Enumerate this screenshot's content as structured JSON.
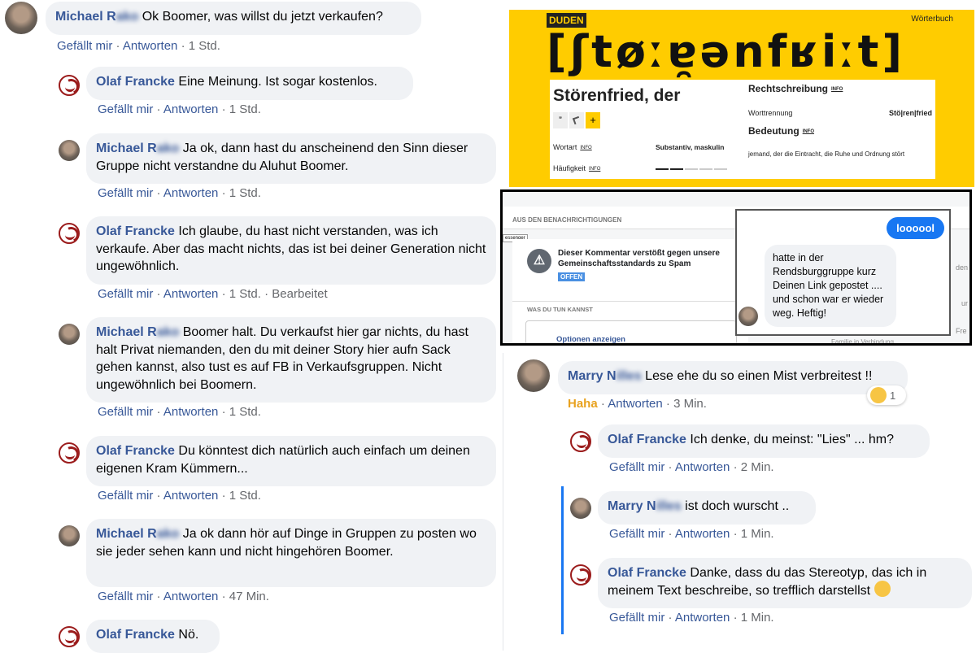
{
  "labels": {
    "like": "Gefällt mir",
    "reply": "Antworten",
    "sep": "·",
    "haha": "Haha"
  },
  "comments": [
    {
      "name_shown": "Michael R",
      "name_blur": "ako",
      "text": "Ok Boomer, was willst du jetzt verkaufen?",
      "time": "1 Std."
    },
    {
      "name_shown": "Olaf Francke",
      "text": "Eine Meinung. Ist sogar kostenlos.",
      "time": "1 Std."
    },
    {
      "name_shown": "Michael R",
      "name_blur": "ako",
      "text": "Ja ok, dann hast du anscheinend den Sinn dieser Gruppe nicht verstandne du Aluhut Boomer.",
      "time": "1 Std."
    },
    {
      "name_shown": "Olaf Francke",
      "text": "Ich glaube, du hast nicht verstanden, was ich verkaufe. Aber das macht nichts, das ist bei deiner Generation nicht ungewöhnlich.",
      "time": "1 Std.",
      "extra": "Bearbeitet"
    },
    {
      "name_shown": "Michael R",
      "name_blur": "ako",
      "text": "Boomer halt. Du verkaufst hier gar nichts, du hast halt Privat niemanden, den du mit deiner Story hier aufn Sack gehen kannst, also tust es auf FB in Verkaufsgruppen. Nicht ungewöhnlich bei Boomern.",
      "time": "1 Std."
    },
    {
      "name_shown": "Olaf Francke",
      "text": "Du könntest dich natürlich auch einfach um deinen eigenen Kram Kümmern...",
      "time": "1 Std."
    },
    {
      "name_shown": "Michael R",
      "name_blur": "ako",
      "text": "Ja ok dann hör auf Dinge in Gruppen zu posten wo sie jeder sehen kann und nicht hingehören Boomer.",
      "time": "47 Min."
    },
    {
      "name_shown": "Olaf Francke",
      "text": "Nö."
    }
  ],
  "right_comments": [
    {
      "name_shown": "Marry N",
      "name_blur": "illes",
      "text": "Lese ehe du so einen Mist verbreitest !!",
      "time": "3 Min.",
      "reaction_count": "1"
    },
    {
      "name_shown": "Olaf Francke",
      "text": "Ich denke, du meinst: \"Lies\" ... hm?",
      "time": "2 Min."
    },
    {
      "name_shown": "Marry N",
      "name_blur": "illes",
      "text": "ist doch wurscht ..",
      "time": "1 Min."
    },
    {
      "name_shown": "Olaf Francke",
      "text": "Danke, dass du das Stereotyp, das ich in meinem Text beschreibe, so trefflich darstellst",
      "time": "1 Min."
    }
  ],
  "duden": {
    "logo": "DUDEN",
    "site": "Wörterbuch",
    "phonetic": "[ʃtøːɐ̯ənfʁiːt]",
    "word": "Störenfried, der",
    "wortart_label": "Wortart",
    "wortart_value": "Substantiv, maskulin",
    "haeufigkeit_label": "Häufigkeit",
    "rechtschreibung": "Rechtschreibung",
    "worttrennung_label": "Worttrennung",
    "worttrennung_value": "Stö|ren|fried",
    "bedeutung": "Bedeutung",
    "bedeutung_text": "jemand, der die Eintracht, die Ruhe und Ordnung stört",
    "info": "INFO",
    "plus": "+",
    "quote": "”"
  },
  "notification": {
    "header": "AUS DEN BENACHRICHTIGUNGEN",
    "tab": "essenger",
    "message": "Dieser Kommentar verstößt gegen unsere Gemeinschaftsstandards zu Spam",
    "status": "OFFEN",
    "what_to_do": "WAS DU TUN KANNST",
    "options": "Optionen anzeigen",
    "right_frag1": "den",
    "right_frag2": "ur",
    "right_frag3": "Fre",
    "footer_frag": "Familie in Verbindung"
  },
  "chat": {
    "sent": "loooool",
    "received": "hatte in der Rendsburggruppe kurz Deinen Link gepostet .... und schon war er wieder weg. Heftig!"
  },
  "colors": {
    "link": "#385898",
    "bubble": "#f0f2f5",
    "duden_yellow": "#ffcc00",
    "messenger_blue": "#1877f2"
  }
}
